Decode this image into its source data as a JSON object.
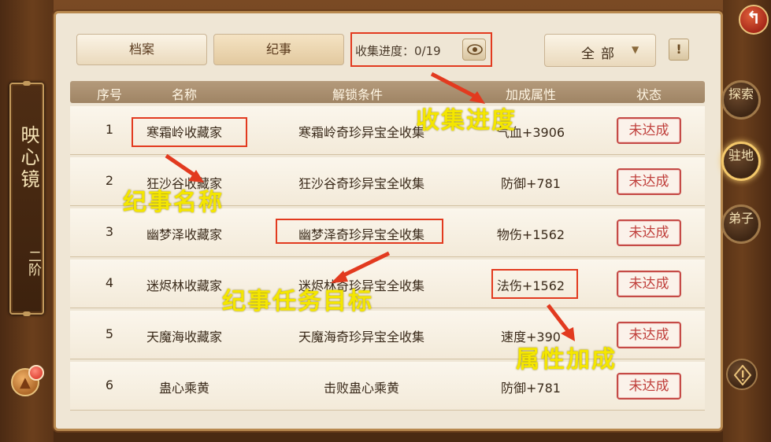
{
  "left_panel": {
    "title": "映心镜",
    "rank": "二阶"
  },
  "tabs": [
    {
      "label": "档案",
      "active": false
    },
    {
      "label": "纪事",
      "active": true
    }
  ],
  "progress": {
    "label": "收集进度：0/19"
  },
  "filter": {
    "selected": "全部"
  },
  "info_button": "!",
  "table": {
    "headers": [
      "序号",
      "名称",
      "解锁条件",
      "加成属性",
      "状态"
    ],
    "rows": [
      {
        "no": "1",
        "name": "寒霜岭收藏家",
        "condition": "寒霜岭奇珍异宝全收集",
        "attribute": "气血+3906",
        "status": "未达成"
      },
      {
        "no": "2",
        "name": "狂沙谷收藏家",
        "condition": "狂沙谷奇珍异宝全收集",
        "attribute": "防御+781",
        "status": "未达成"
      },
      {
        "no": "3",
        "name": "幽梦泽收藏家",
        "condition": "幽梦泽奇珍异宝全收集",
        "attribute": "物伤+1562",
        "status": "未达成"
      },
      {
        "no": "4",
        "name": "迷烬林收藏家",
        "condition": "迷烬林奇珍异宝全收集",
        "attribute": "法伤+1562",
        "status": "未达成"
      },
      {
        "no": "5",
        "name": "天魔海收藏家",
        "condition": "天魔海奇珍异宝全收集",
        "attribute": "速度+390",
        "status": "未达成"
      },
      {
        "no": "6",
        "name": "蛊心乘黄",
        "condition": "击败蛊心乘黄",
        "attribute": "防御+781",
        "status": "未达成"
      }
    ]
  },
  "annotations": {
    "progress": "收集进度",
    "name": "纪事名称",
    "target": "纪事任务目标",
    "attribute": "属性加成"
  },
  "right_panel": {
    "buttons": [
      {
        "label": "探索",
        "active": false
      },
      {
        "label": "驻地",
        "active": true
      },
      {
        "label": "弟子",
        "active": false
      }
    ]
  },
  "colors": {
    "highlight": "#e23a1f",
    "annotation": "#f4e600",
    "stamp": "#c0403c"
  }
}
